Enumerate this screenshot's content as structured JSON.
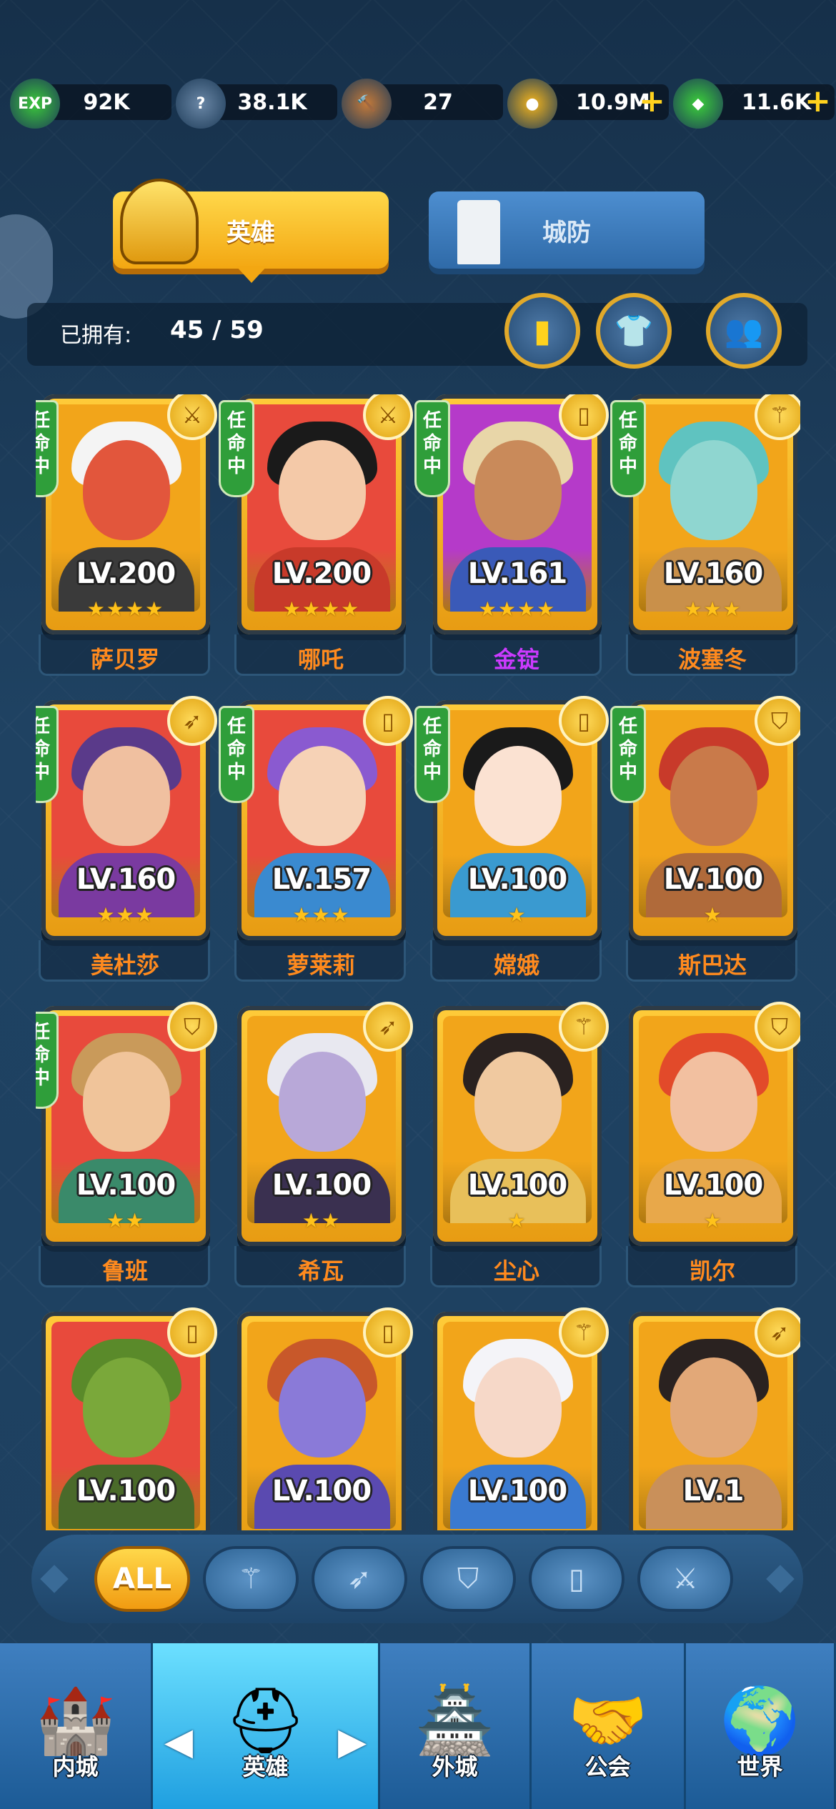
{
  "resources": [
    {
      "icon": "exp-icon",
      "value": "92K",
      "color": "#3cc93a",
      "glyph": "EXP"
    },
    {
      "icon": "tombstone-icon",
      "value": "38.1K",
      "color": "#6a87a6",
      "glyph": "?"
    },
    {
      "icon": "hammer-icon",
      "value": "27",
      "color": "#c47a3a",
      "glyph": "🔨"
    },
    {
      "icon": "gold-coin-icon",
      "value": "10.9M",
      "color": "#f3b41d",
      "glyph": "●",
      "plus": true
    },
    {
      "icon": "green-gem-icon",
      "value": "11.6K",
      "color": "#3ccf3a",
      "glyph": "◆",
      "plus": true
    }
  ],
  "tabs": {
    "hero": "英雄",
    "defense": "城防"
  },
  "owned": {
    "label": "已拥有:",
    "count": "45 / 59"
  },
  "heroes": [
    {
      "name": "萨贝罗",
      "level": "LV.200",
      "stars": "★★★★",
      "appointed": true,
      "class_icon": "sword-icon",
      "bg": "#f2a51a",
      "skin": "#e2563c",
      "hair": "#f4f4f4",
      "body": "#3a3a3a"
    },
    {
      "name": "哪吒",
      "level": "LV.200",
      "stars": "★★★★",
      "appointed": true,
      "class_icon": "sword-icon",
      "bg": "#e84a3c",
      "skin": "#f4c9a8",
      "hair": "#1a1a1a",
      "body": "#c83a2a"
    },
    {
      "name": "金锭",
      "level": "LV.161",
      "stars": "★★★★",
      "appointed": true,
      "class_icon": "book-icon",
      "bg": "#b53ac9",
      "skin": "#c98a5a",
      "hair": "#e8d6a8",
      "body": "#3a5ab8",
      "purple": true
    },
    {
      "name": "波塞冬",
      "level": "LV.160",
      "stars": "★★★",
      "appointed": true,
      "class_icon": "staff-icon",
      "bg": "#f2a51a",
      "skin": "#8fd6d0",
      "hair": "#5fc3c0",
      "body": "#c9904a"
    },
    {
      "name": "美杜莎",
      "level": "LV.160",
      "stars": "★★★",
      "appointed": true,
      "class_icon": "bow-icon",
      "bg": "#e84a3c",
      "skin": "#f0c0a0",
      "hair": "#5a3a8a",
      "body": "#7a3aa0"
    },
    {
      "name": "萝莱莉",
      "level": "LV.157",
      "stars": "★★★",
      "appointed": true,
      "class_icon": "book-icon",
      "bg": "#e84a3c",
      "skin": "#f6d2b6",
      "hair": "#8a5ad0",
      "body": "#3a8ad0"
    },
    {
      "name": "嫦娥",
      "level": "LV.100",
      "stars": "★",
      "appointed": true,
      "class_icon": "book-icon",
      "bg": "#f2a51a",
      "skin": "#fbe2d2",
      "hair": "#1a1a1a",
      "body": "#3a9ad0"
    },
    {
      "name": "斯巴达",
      "level": "LV.100",
      "stars": "★",
      "appointed": true,
      "class_icon": "shield-icon",
      "bg": "#f2a51a",
      "skin": "#c97a4a",
      "hair": "#c83a2a",
      "body": "#b06a3a"
    },
    {
      "name": "鲁班",
      "level": "LV.100",
      "stars": "★★",
      "appointed": true,
      "class_icon": "shield-icon",
      "bg": "#e84a3c",
      "skin": "#f0c49a",
      "hair": "#c99a5a",
      "body": "#3a8a6a"
    },
    {
      "name": "希瓦",
      "level": "LV.100",
      "stars": "★★",
      "appointed": false,
      "class_icon": "bow-icon",
      "bg": "#f2a51a",
      "skin": "#b8a8d8",
      "hair": "#e8e8f0",
      "body": "#3a3050"
    },
    {
      "name": "尘心",
      "level": "LV.100",
      "stars": "★",
      "appointed": false,
      "class_icon": "staff-icon",
      "bg": "#f2a51a",
      "skin": "#f0c9a0",
      "hair": "#2a2220",
      "body": "#e8c05a"
    },
    {
      "name": "凯尔",
      "level": "LV.100",
      "stars": "★",
      "appointed": false,
      "class_icon": "shield-icon",
      "bg": "#f2a51a",
      "skin": "#f2c0a0",
      "hair": "#e24a2a",
      "body": "#e8a84a"
    },
    {
      "name": "",
      "level": "LV.100",
      "stars": "",
      "appointed": false,
      "class_icon": "book-icon",
      "bg": "#e84a3c",
      "skin": "#7aa83a",
      "hair": "#5a8a2a",
      "body": "#4a6a2a"
    },
    {
      "name": "",
      "level": "LV.100",
      "stars": "",
      "appointed": false,
      "class_icon": "book-icon",
      "bg": "#f2a51a",
      "skin": "#8a7ad8",
      "hair": "#c8582a",
      "body": "#5a4ab0"
    },
    {
      "name": "",
      "level": "LV.100",
      "stars": "",
      "appointed": false,
      "class_icon": "staff-icon",
      "bg": "#f2a51a",
      "skin": "#f6d8c8",
      "hair": "#f4f4f8",
      "body": "#3a7ad0"
    },
    {
      "name": "",
      "level": "LV.1",
      "stars": "",
      "appointed": false,
      "class_icon": "bow-icon",
      "bg": "#f2a51a",
      "skin": "#e2a878",
      "hair": "#2a2220",
      "body": "#c9905a"
    }
  ],
  "appointed_label": "任命中",
  "filters": [
    {
      "name": "filter-all",
      "label": "ALL"
    },
    {
      "name": "filter-staff",
      "label": "⚚"
    },
    {
      "name": "filter-bow",
      "label": "➶"
    },
    {
      "name": "filter-shield",
      "label": "⛉"
    },
    {
      "name": "filter-book",
      "label": "▯"
    },
    {
      "name": "filter-sword",
      "label": "⚔"
    }
  ],
  "nav": [
    {
      "name": "nav-inner-city",
      "label": "内城",
      "icon": "castle-icon",
      "glyph": "🏰"
    },
    {
      "name": "nav-hero",
      "label": "英雄",
      "icon": "helmet-icon",
      "glyph": "⛑",
      "active": true
    },
    {
      "name": "nav-outer-city",
      "label": "外城",
      "icon": "tower-icon",
      "glyph": "🏯"
    },
    {
      "name": "nav-guild",
      "label": "公会",
      "icon": "handshake-icon",
      "glyph": "🤝"
    },
    {
      "name": "nav-world",
      "label": "世界",
      "icon": "globe-icon",
      "glyph": "🌍"
    }
  ]
}
